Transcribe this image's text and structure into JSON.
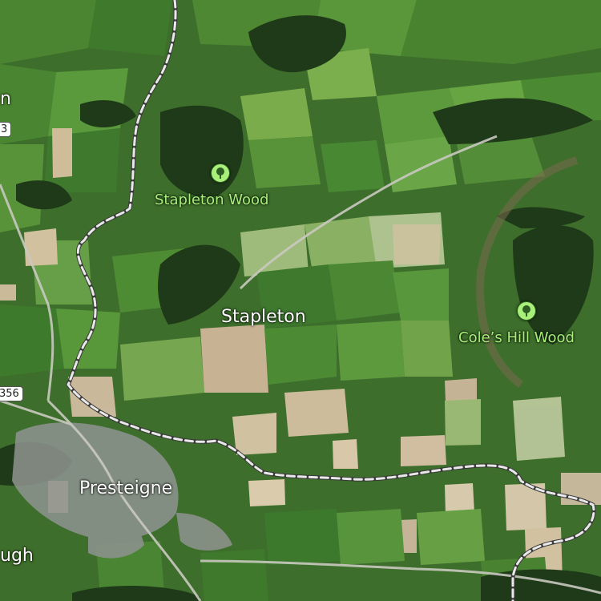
{
  "map": {
    "type": "satellite",
    "colors": {
      "field_dark": "#2f5e24",
      "field_mid": "#4f8a33",
      "field_light": "#78ad4c",
      "bare_field": "#cdb79a",
      "woodland": "#1f3a18",
      "boundary_line": "#e8e8e8",
      "settlement": "#8f9490",
      "poi_green": "#a8f07a"
    }
  },
  "labels": {
    "stapleton_wood": "Stapleton Wood",
    "coles_hill_wood": "Cole’s Hill Wood",
    "stapleton": "Stapleton",
    "presteigne": "Presteigne",
    "edge_left_top": "n",
    "edge_left_bottom": "ugh"
  },
  "road_shields": {
    "left_top": "3",
    "b4356": "356"
  },
  "icons": {
    "stapleton_wood": "tree-icon",
    "coles_hill_wood": "tree-icon"
  }
}
